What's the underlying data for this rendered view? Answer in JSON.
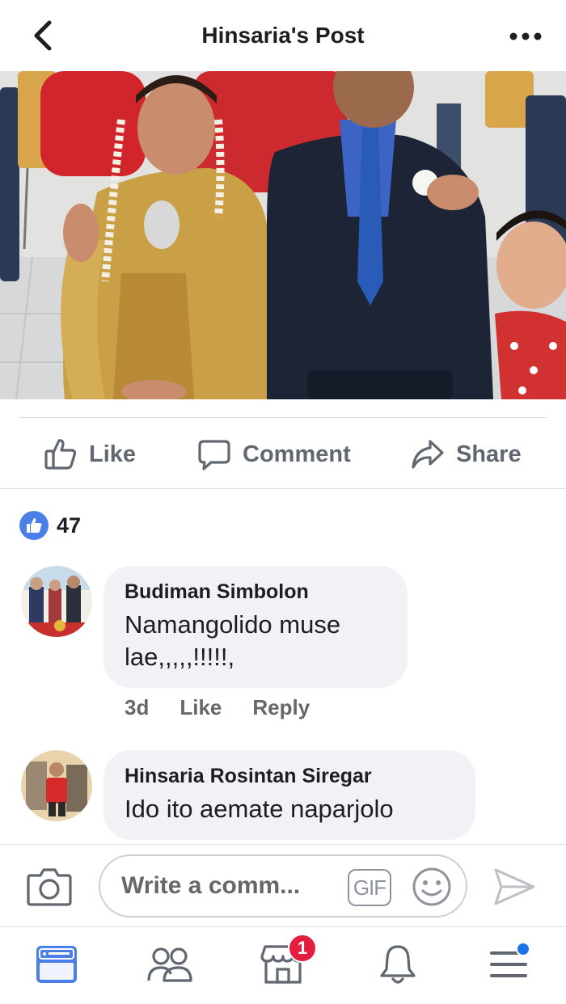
{
  "header": {
    "title": "Hinsaria's Post",
    "back_icon": "chevron-left-icon",
    "more_icon": "more-horizontal-icon"
  },
  "post": {
    "photo": "wedding-couple-photo"
  },
  "actions": {
    "like_label": "Like",
    "comment_label": "Comment",
    "share_label": "Share"
  },
  "reactions": {
    "count": "47",
    "color": "#4a7fe8"
  },
  "comments": [
    {
      "author": "Budiman Simbolon",
      "text": "Namangolido muse lae,,,,,!!!!!,",
      "time": "3d",
      "like_label": "Like",
      "reply_label": "Reply"
    },
    {
      "author": "Hinsaria Rosintan Siregar",
      "text": "Ido ito aemate naparjolo"
    }
  ],
  "composer": {
    "placeholder": "Write a comm...",
    "gif_label": "GIF"
  },
  "navbar": {
    "items": [
      "news-feed",
      "friends",
      "marketplace",
      "notifications",
      "menu"
    ],
    "marketplace_badge": "1",
    "active_color": "#1b74e4"
  }
}
